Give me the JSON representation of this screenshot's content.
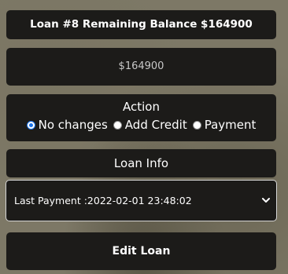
{
  "header": {
    "title": "Loan #8 Remaining Balance $164900"
  },
  "balance": {
    "value": "$164900"
  },
  "action": {
    "label": "Action",
    "options": [
      {
        "label": "No changes",
        "checked": true
      },
      {
        "label": "Add Credit",
        "checked": false
      },
      {
        "label": "Payment",
        "checked": false
      }
    ]
  },
  "loan_info": {
    "label": "Loan Info",
    "selected": "Last Payment :2022-02-01 23:48:02"
  },
  "submit": {
    "label": "Edit Loan"
  },
  "colors": {
    "radio_accent": "#1a73e8",
    "panel_bg": "#1c1b19"
  },
  "icons": {
    "select_arrow": "chevron-down-icon"
  }
}
